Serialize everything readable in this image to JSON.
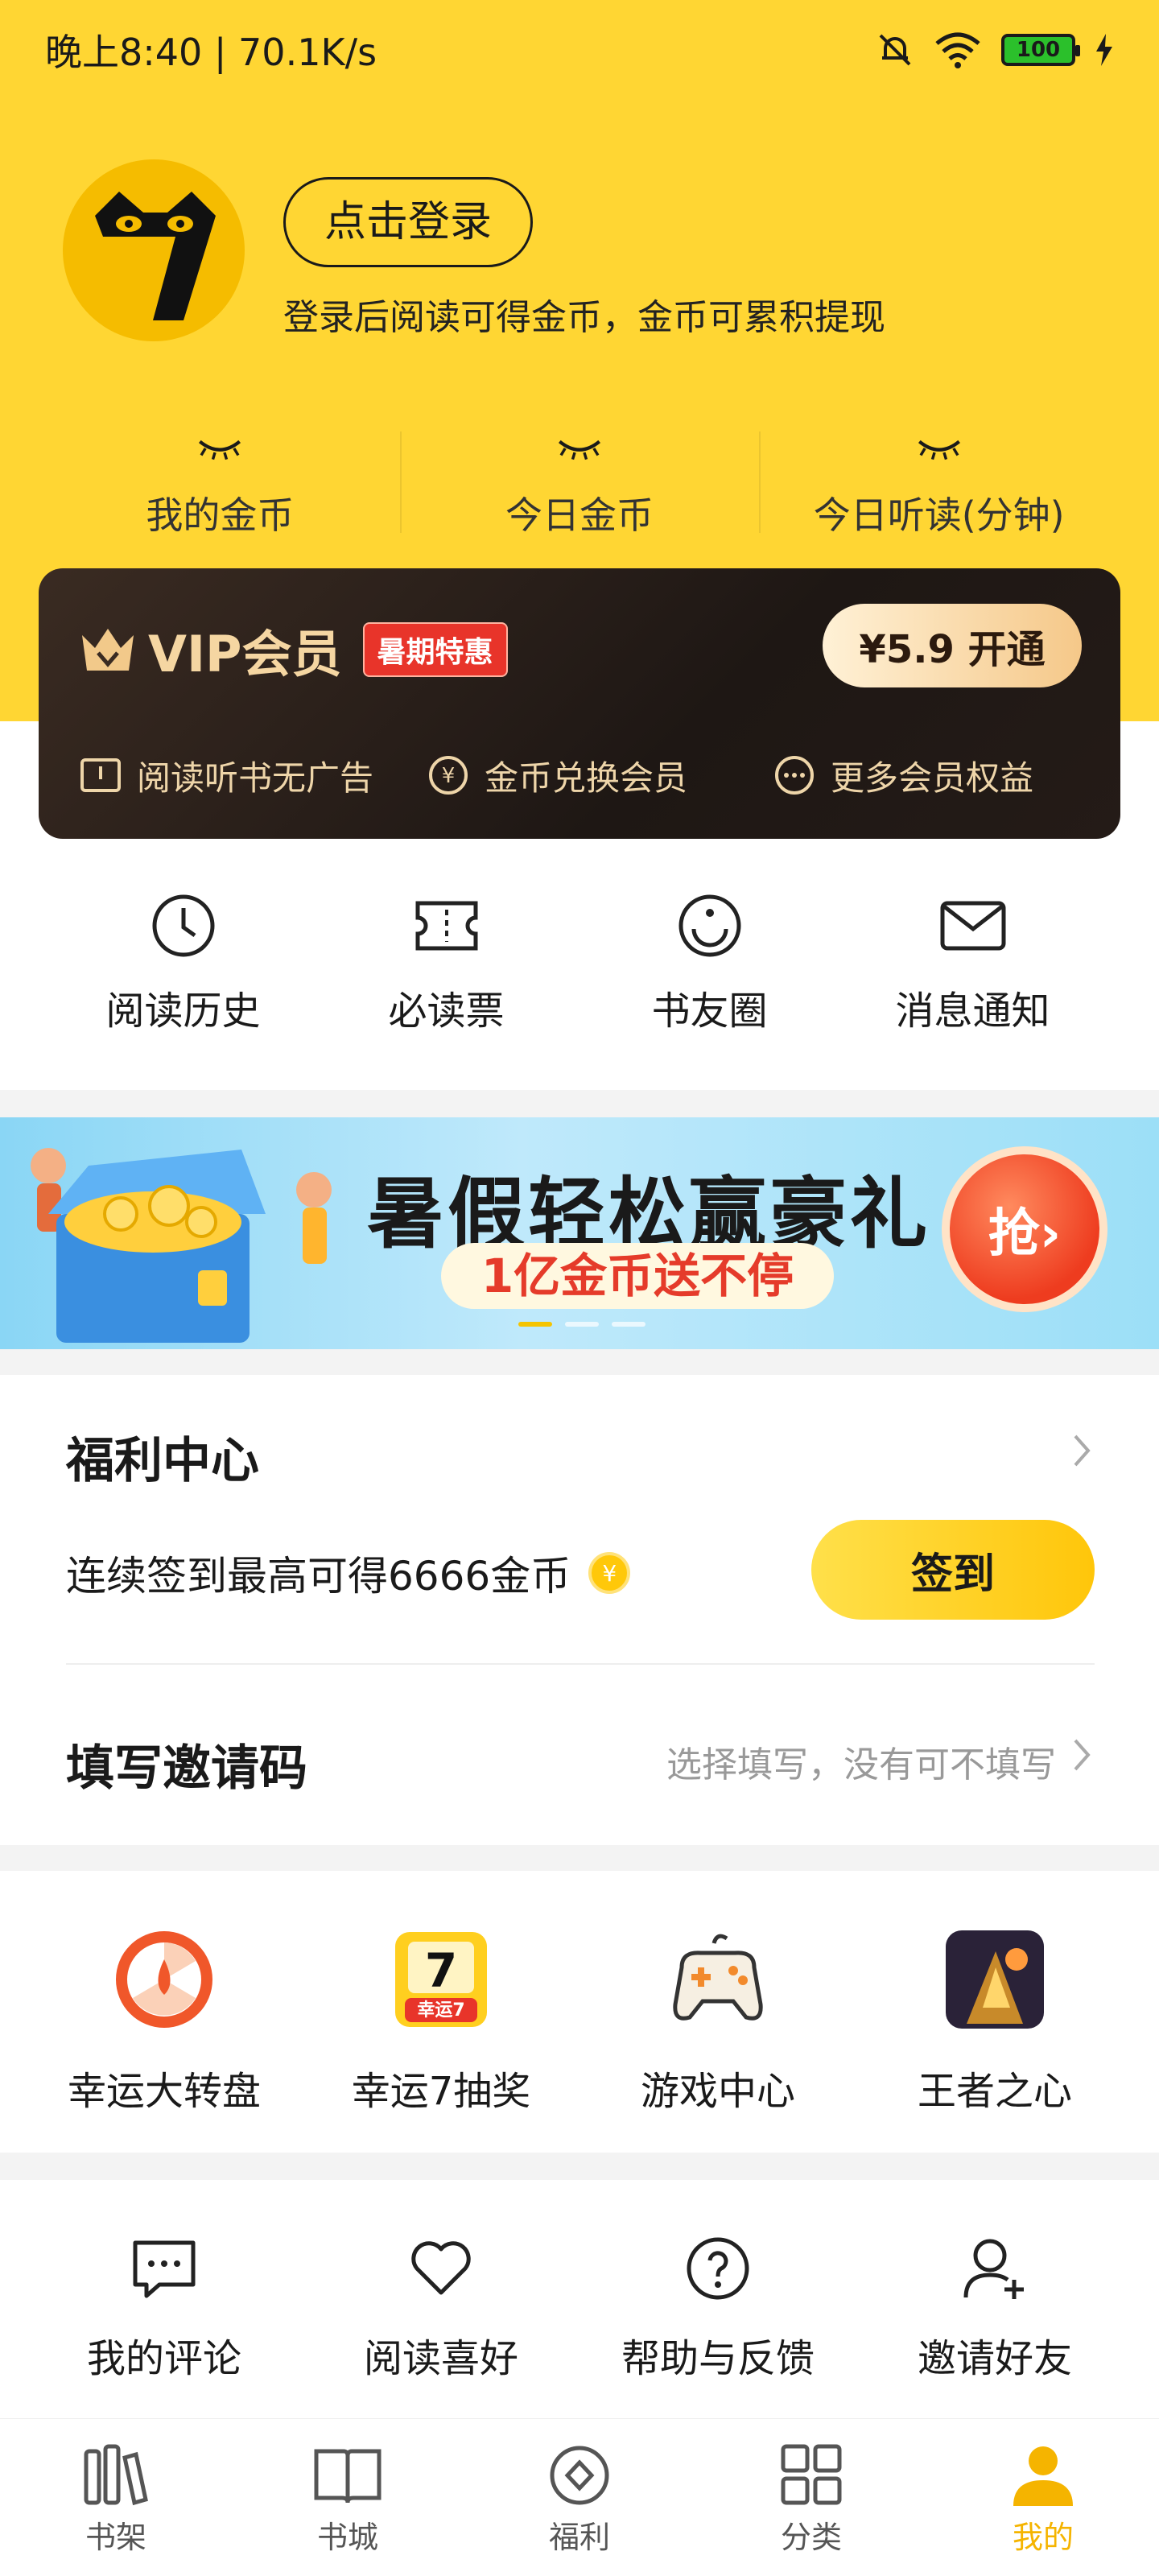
{
  "status": {
    "time_speed": "晚上8:40 | 70.1K/s",
    "battery": "100"
  },
  "profile": {
    "login_label": "点击登录",
    "login_hint": "登录后阅读可得金币，金币可累积提现"
  },
  "stats": [
    {
      "label": "我的金币"
    },
    {
      "label": "今日金币"
    },
    {
      "label": "今日听读(分钟)"
    }
  ],
  "vip": {
    "title": "VIP会员",
    "badge": "暑期特惠",
    "open_label": "¥5.9 开通",
    "perks": [
      {
        "label": "阅读听书无广告",
        "icon": "book-icon"
      },
      {
        "label": "金币兑换会员",
        "icon": "coin-icon"
      },
      {
        "label": "更多会员权益",
        "icon": "more-icon"
      }
    ],
    "color_gold": "#f5d6a2"
  },
  "quick": [
    {
      "label": "阅读历史",
      "icon": "clock-icon"
    },
    {
      "label": "必读票",
      "icon": "ticket-icon"
    },
    {
      "label": "书友圈",
      "icon": "circle-icon"
    },
    {
      "label": "消息通知",
      "icon": "mail-icon"
    }
  ],
  "banner": {
    "title": "暑假轻松赢豪礼",
    "subtitle": "1亿金币送不停",
    "cta": "抢›"
  },
  "welfare": {
    "title": "福利中心",
    "sign_text": "连续签到最高可得6666金币",
    "sign_button": "签到",
    "invite_title": "填写邀请码",
    "invite_hint": "选择填写，没有可不填写"
  },
  "games": [
    {
      "label": "幸运大转盘",
      "icon": "wheel-icon"
    },
    {
      "label": "幸运7抽奖",
      "icon": "lucky7-icon",
      "badge": "幸运7"
    },
    {
      "label": "游戏中心",
      "icon": "gamepad-icon"
    },
    {
      "label": "王者之心",
      "icon": "game-thumb-icon"
    }
  ],
  "tools": [
    {
      "label": "我的评论",
      "icon": "comment-icon"
    },
    {
      "label": "阅读喜好",
      "icon": "heart-icon"
    },
    {
      "label": "帮助与反馈",
      "icon": "help-icon"
    },
    {
      "label": "邀请好友",
      "icon": "add-user-icon"
    }
  ],
  "tabs": [
    {
      "label": "书架",
      "icon": "bookshelf-icon"
    },
    {
      "label": "书城",
      "icon": "open-book-icon"
    },
    {
      "label": "福利",
      "icon": "welfare-icon"
    },
    {
      "label": "分类",
      "icon": "grid-icon"
    },
    {
      "label": "我的",
      "icon": "person-icon",
      "active": true
    }
  ],
  "colors": {
    "brand_yellow": "#ffd633",
    "active_tab": "#f5b400"
  }
}
